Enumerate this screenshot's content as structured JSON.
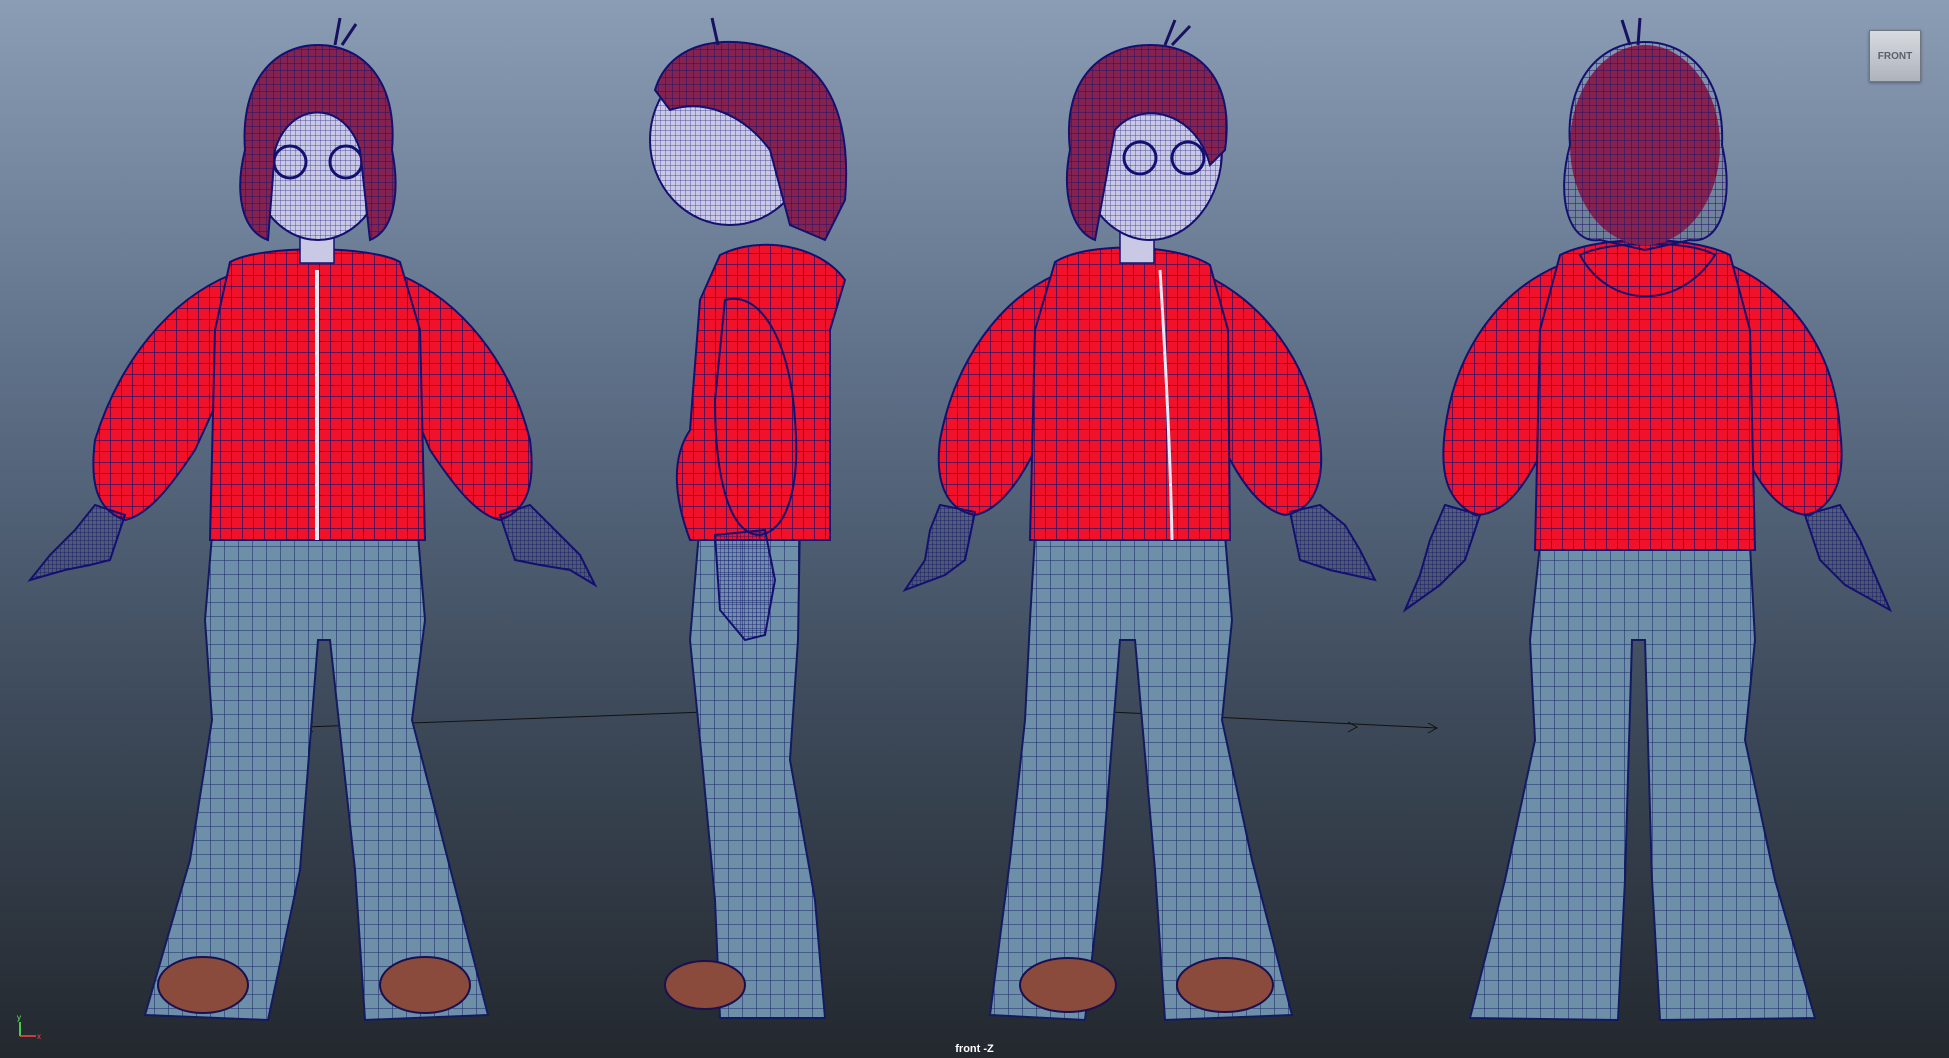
{
  "viewport": {
    "camera_label": "front -Z",
    "view_cube_label": "FRONT"
  },
  "axis_gizmo": {
    "y_label": "y",
    "x_label": "x",
    "y_color": "#5cff5c",
    "x_color": "#ff4444"
  },
  "colors": {
    "hoodie": "#f0112b",
    "jeans": "#6d8fa8",
    "skin": "#c9c9e6",
    "hair": "#84234f",
    "shoes": "#8a4a3c",
    "wire": "#101070"
  }
}
